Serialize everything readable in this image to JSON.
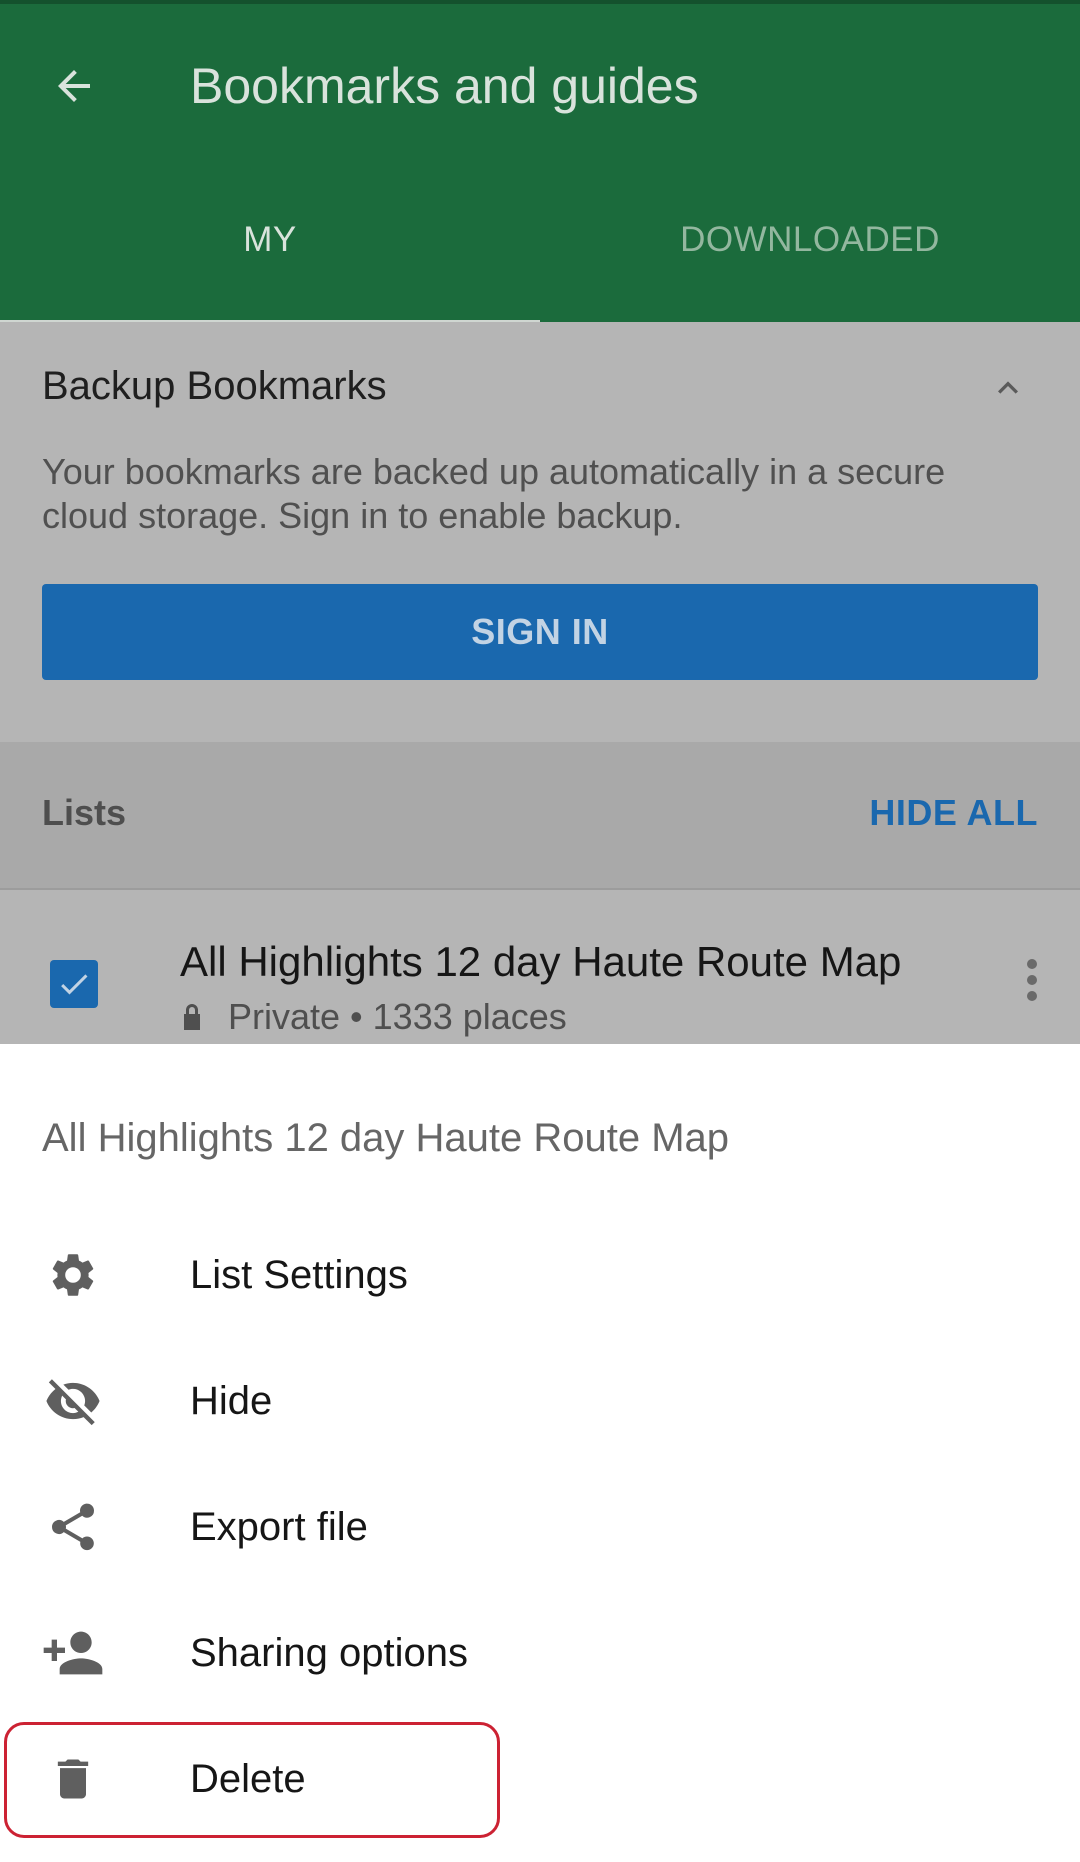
{
  "header": {
    "title": "Bookmarks and guides"
  },
  "tabs": [
    {
      "label": "MY",
      "active": true
    },
    {
      "label": "DOWNLOADED",
      "active": false
    }
  ],
  "backup": {
    "title": "Backup Bookmarks",
    "description": "Your bookmarks are backed up automatically in a secure cloud storage. Sign in to enable backup.",
    "button_label": "SIGN IN"
  },
  "lists": {
    "label": "Lists",
    "hide_all_label": "HIDE ALL",
    "items": [
      {
        "title": "All Highlights 12 day Haute Route Map",
        "subtitle": "Private • 1333 places",
        "checked": true
      }
    ]
  },
  "sheet": {
    "title": "All Highlights 12 day Haute Route Map",
    "items": [
      {
        "label": "List Settings",
        "icon": "gear-icon"
      },
      {
        "label": "Hide",
        "icon": "eye-off-icon"
      },
      {
        "label": "Export file",
        "icon": "share-icon"
      },
      {
        "label": "Sharing options",
        "icon": "add-person-icon"
      },
      {
        "label": "Delete",
        "icon": "trash-icon",
        "highlighted": true
      }
    ]
  },
  "colors": {
    "appbar": "#1b6b3c",
    "accent_blue": "#1a68ae",
    "highlight_red": "#cc2233"
  }
}
